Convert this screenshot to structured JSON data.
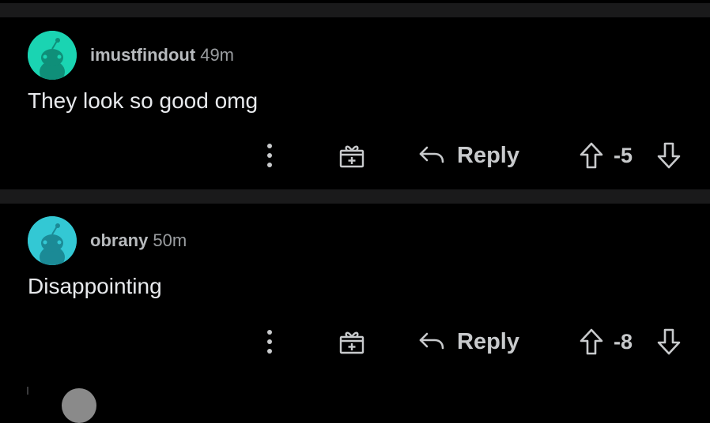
{
  "comments": [
    {
      "username": "imustfindout",
      "time": "49m",
      "body": "They look so good omg",
      "score": "-5",
      "reply_label": "Reply",
      "avatar_color": "#1ad4b2"
    },
    {
      "username": "obrany",
      "time": "50m",
      "body": "Disappointing",
      "score": "-8",
      "reply_label": "Reply",
      "avatar_color": "#33c8d4"
    }
  ],
  "icons": {
    "more": "vertical-ellipsis",
    "award": "gift-plus",
    "reply": "reply-arrow",
    "upvote": "arrow-up-outline",
    "downvote": "arrow-down-outline"
  },
  "colors": {
    "background": "#000000",
    "divider": "#1a1a1b",
    "text": "#e8eaed",
    "muted": "#9a9da0"
  }
}
